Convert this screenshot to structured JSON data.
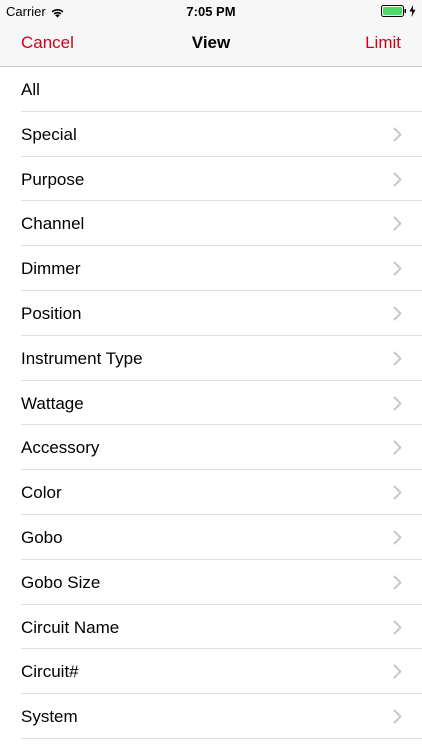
{
  "status_bar": {
    "carrier": "Carrier",
    "time": "7:05 PM",
    "battery_color": "#4cd964"
  },
  "nav": {
    "left_label": "Cancel",
    "title": "View",
    "right_label": "Limit",
    "accent_color": "#d0021b"
  },
  "list": {
    "items": [
      {
        "label": "All",
        "chevron": false
      },
      {
        "label": "Special",
        "chevron": true
      },
      {
        "label": "Purpose",
        "chevron": true
      },
      {
        "label": "Channel",
        "chevron": true
      },
      {
        "label": "Dimmer",
        "chevron": true
      },
      {
        "label": "Position",
        "chevron": true
      },
      {
        "label": "Instrument Type",
        "chevron": true
      },
      {
        "label": "Wattage",
        "chevron": true
      },
      {
        "label": "Accessory",
        "chevron": true
      },
      {
        "label": "Color",
        "chevron": true
      },
      {
        "label": "Gobo",
        "chevron": true
      },
      {
        "label": "Gobo Size",
        "chevron": true
      },
      {
        "label": "Circuit Name",
        "chevron": true
      },
      {
        "label": "Circuit#",
        "chevron": true
      },
      {
        "label": "System",
        "chevron": true
      }
    ],
    "chevron_icon": "chevron-right-icon"
  }
}
